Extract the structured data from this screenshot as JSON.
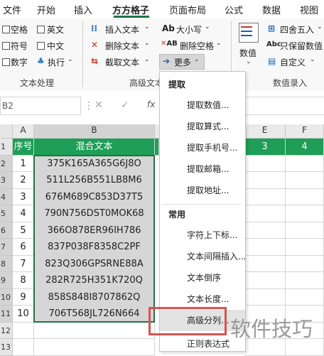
{
  "tabs": [
    "文件",
    "开始",
    "插入",
    "方方格子",
    "页面布局",
    "公式",
    "数据",
    "视图"
  ],
  "active_tab": "方方格子",
  "ribbon": {
    "checkboxes_col1": [
      "空格",
      "符号",
      "数字"
    ],
    "checkboxes_col2": [
      "英文",
      "中文"
    ],
    "execute": "执行",
    "text_ops": [
      "插入文本",
      "删除文本",
      "截取文本"
    ],
    "case_label": "大小写",
    "delete_space": "删除空格",
    "more": "更多",
    "numeric_label": "数值",
    "round": "四舍五入",
    "keep_numbers": "只保留数值",
    "custom": "自定义",
    "group_text": "文本处理",
    "group_adv": "高级文本",
    "group_data": "数值录入"
  },
  "formula_bar": {
    "cell_ref": "B2",
    "fx": "fx"
  },
  "sheet": {
    "col_headers": [
      "A",
      "B",
      "E",
      "F"
    ],
    "header_row": [
      "序号",
      "混合文本"
    ],
    "header_extra": [
      "3",
      "4"
    ],
    "row_numbers": [
      "1",
      "2",
      "3",
      "4",
      "5",
      "6",
      "7",
      "8",
      "9",
      "10",
      "11",
      "12",
      "13"
    ],
    "rows": [
      [
        "1",
        "375K165A365G6J8O"
      ],
      [
        "2",
        "511L256B551LB8M6"
      ],
      [
        "3",
        "676M689C853D37T5"
      ],
      [
        "4",
        "790N756DST0MOK68"
      ],
      [
        "5",
        "366O878ER96IH786"
      ],
      [
        "6",
        "837P038F8358C2PF"
      ],
      [
        "7",
        "823Q306GPSRNE88A"
      ],
      [
        "8",
        "282R725H351K720Q"
      ],
      [
        "9",
        "858S848I8707862Q"
      ],
      [
        "10",
        "706T568JL726N664"
      ]
    ]
  },
  "dropdown": {
    "section1": "提取",
    "items1": [
      "提取数值...",
      "提取算式...",
      "提取手机号...",
      "提取邮箱...",
      "提取地址..."
    ],
    "section2": "常用",
    "items2": [
      "字符上下标...",
      "文本间隔插入...",
      "文本倒序",
      "文本长度...",
      "高级分列...",
      "正则表达式"
    ]
  },
  "watermark": "软件技巧",
  "colors": {
    "green": "#217346",
    "header_fill": "#1e9e56",
    "highlight": "#d9534f"
  }
}
